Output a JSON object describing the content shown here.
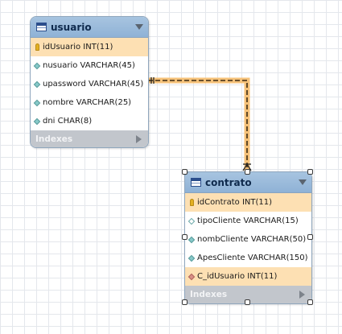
{
  "tables": [
    {
      "title": "usuario",
      "columns": [
        {
          "name": "idUsuario INT(11)",
          "kind": "primary-key"
        },
        {
          "name": "nusuario VARCHAR(45)",
          "kind": "not-null"
        },
        {
          "name": "upassword VARCHAR(45)",
          "kind": "not-null"
        },
        {
          "name": "nombre VARCHAR(25)",
          "kind": "not-null"
        },
        {
          "name": "dni CHAR(8)",
          "kind": "not-null"
        }
      ],
      "indexes_label": "Indexes"
    },
    {
      "title": "contrato",
      "columns": [
        {
          "name": "idContrato INT(11)",
          "kind": "primary-key"
        },
        {
          "name": "tipoCliente VARCHAR(15)",
          "kind": "nullable"
        },
        {
          "name": "nombCliente VARCHAR(50)",
          "kind": "not-null"
        },
        {
          "name": "ApesCliente VARCHAR(150)",
          "kind": "not-null"
        },
        {
          "name": "C_idUsuario INT(11)",
          "kind": "foreign-key"
        }
      ],
      "indexes_label": "Indexes"
    }
  ],
  "relationship": {
    "from": "usuario",
    "to": "contrato",
    "cardinality": "one-to-many",
    "highlight_color": "#f3b14a"
  },
  "colors": {
    "header": "#9dbddd",
    "key_row": "#fde0b3",
    "indexes_bar": "#c2c6cc"
  }
}
